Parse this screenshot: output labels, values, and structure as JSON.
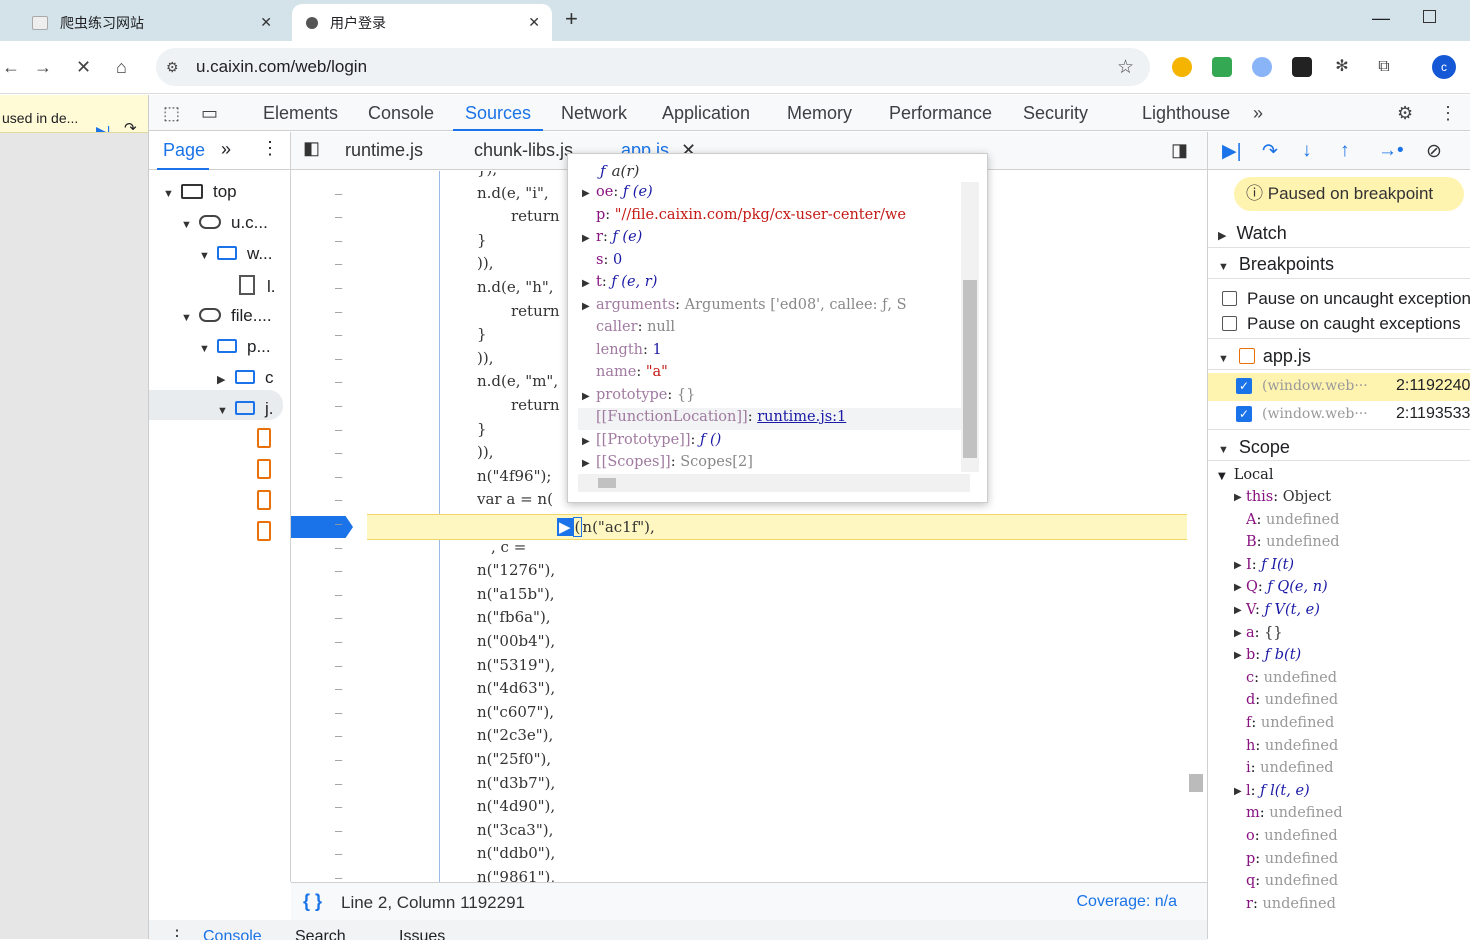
{
  "browser": {
    "tabs": [
      {
        "title": "爬虫练习网站",
        "active": false
      },
      {
        "title": "用户登录",
        "active": true
      }
    ],
    "url": "u.caixin.com/web/login",
    "profile_initial": "c"
  },
  "page_strip": {
    "debug_text": "used in de..."
  },
  "devtools": {
    "main_tabs": [
      "Elements",
      "Console",
      "Sources",
      "Network",
      "Application",
      "Memory",
      "Performance",
      "Security",
      "Lighthouse"
    ],
    "selected_tab": "Sources",
    "navigator": {
      "tab": "Page",
      "tree": [
        "top",
        "u.c...",
        "w...",
        "l.",
        "file....",
        "p...",
        "c",
        "j."
      ]
    },
    "editor": {
      "file_tabs": [
        "runtime.js",
        "chunk-libs.js",
        "app.js"
      ],
      "code_lines": [
        {
          "text": "}),",
          "indent": 476
        },
        {
          "text": "n.d(e, \"i\",",
          "indent": 476
        },
        {
          "text": "return",
          "indent": 510
        },
        {
          "text": "}",
          "indent": 476
        },
        {
          "text": ")),",
          "indent": 476
        },
        {
          "text": "n.d(e, \"h\",",
          "indent": 476
        },
        {
          "text": "return",
          "indent": 510
        },
        {
          "text": "}",
          "indent": 476
        },
        {
          "text": ")),",
          "indent": 476
        },
        {
          "text": "n.d(e, \"m\",",
          "indent": 476
        },
        {
          "text": "return",
          "indent": 510
        },
        {
          "text": "}",
          "indent": 476
        },
        {
          "text": ")),",
          "indent": 476
        },
        {
          "text": "n(\"4f96\");",
          "indent": 476
        },
        {
          "text": "var a = n(",
          "indent": 476
        },
        {
          "text": ", c = ",
          "indent": 490
        },
        {
          "text": "n(\"1276\"),",
          "indent": 476
        },
        {
          "text": "n(\"a15b\"),",
          "indent": 476
        },
        {
          "text": "n(\"fb6a\"),",
          "indent": 476
        },
        {
          "text": "n(\"00b4\"),",
          "indent": 476
        },
        {
          "text": "n(\"5319\"),",
          "indent": 476
        },
        {
          "text": "n(\"4d63\"),",
          "indent": 476
        },
        {
          "text": "n(\"c607\"),",
          "indent": 476
        },
        {
          "text": "n(\"2c3e\"),",
          "indent": 476
        },
        {
          "text": "n(\"25f0\"),",
          "indent": 476
        },
        {
          "text": "n(\"d3b7\"),",
          "indent": 476
        },
        {
          "text": "n(\"4d90\"),",
          "indent": 476
        },
        {
          "text": "n(\"3ca3\"),",
          "indent": 476
        },
        {
          "text": "n(\"ddb0\"),",
          "indent": 476
        },
        {
          "text": "n(\"9861\"),",
          "indent": 476
        }
      ],
      "exec_call": "n(\"ac1f\"),",
      "gutter_mark": "–",
      "status": {
        "position": "Line 2, Column 1192291",
        "coverage": "Coverage: n/a"
      }
    },
    "popover": {
      "header_fn": "ƒ",
      "header_sig": "a(r)",
      "rows": [
        {
          "key": "oe",
          "value": "ƒ (e)",
          "expandable": true,
          "kind": "fn"
        },
        {
          "key": "p",
          "value": "\"//file.caixin.com/pkg/cx-user-center/we",
          "expandable": false,
          "kind": "str"
        },
        {
          "key": "r",
          "value": "ƒ (e)",
          "expandable": true,
          "kind": "fn"
        },
        {
          "key": "s",
          "value": "0",
          "expandable": false,
          "kind": "num"
        },
        {
          "key": "t",
          "value": "ƒ (e, r)",
          "expandable": true,
          "kind": "fn"
        },
        {
          "key": "arguments",
          "value": "Arguments  ['ed08', callee: ƒ, S",
          "expandable": true,
          "kind": "gray"
        },
        {
          "key": "caller",
          "value": "null",
          "expandable": false,
          "kind": "gray"
        },
        {
          "key": "length",
          "value": "1",
          "expandable": false,
          "kind": "num"
        },
        {
          "key": "name",
          "value": "\"a\"",
          "expandable": false,
          "kind": "str"
        },
        {
          "key": "prototype",
          "value": "{}",
          "expandable": true,
          "kind": "obj"
        },
        {
          "key": "[[FunctionLocation]]",
          "value": "runtime.js:1",
          "expandable": false,
          "kind": "link"
        },
        {
          "key": "[[Prototype]]",
          "value": "ƒ ()",
          "expandable": true,
          "kind": "fn"
        },
        {
          "key": "[[Scopes]]",
          "value": "Scopes[2]",
          "expandable": true,
          "kind": "obj"
        }
      ]
    },
    "debugger": {
      "paused_text": "Paused on breakpoint",
      "sections": {
        "watch": "Watch",
        "breakpoints": "Breakpoints",
        "scope": "Scope",
        "local": "Local"
      },
      "pause_uncaught": "Pause on uncaught exceptions",
      "pause_caught": "Pause on caught exceptions",
      "bp_file": "app.js",
      "breakpoints": [
        {
          "src": "(window.web···",
          "loc": "2:1192240"
        },
        {
          "src": "(window.web···",
          "loc": "2:1193533"
        }
      ],
      "scope_vars": [
        {
          "k": "this",
          "v": "Object",
          "kind": "obj",
          "expandable": true
        },
        {
          "k": "A",
          "v": "undefined",
          "kind": "undef",
          "expandable": false
        },
        {
          "k": "B",
          "v": "undefined",
          "kind": "undef",
          "expandable": false
        },
        {
          "k": "I",
          "v": "ƒ I(t)",
          "kind": "fn",
          "expandable": true
        },
        {
          "k": "Q",
          "v": "ƒ Q(e, n)",
          "kind": "fn",
          "expandable": true
        },
        {
          "k": "V",
          "v": "ƒ V(t, e)",
          "kind": "fn",
          "expandable": true
        },
        {
          "k": "a",
          "v": "{}",
          "kind": "obj",
          "expandable": true
        },
        {
          "k": "b",
          "v": "ƒ b(t)",
          "kind": "fn",
          "expandable": true
        },
        {
          "k": "c",
          "v": "undefined",
          "kind": "undef",
          "expandable": false
        },
        {
          "k": "d",
          "v": "undefined",
          "kind": "undef",
          "expandable": false
        },
        {
          "k": "f",
          "v": "undefined",
          "kind": "undef",
          "expandable": false
        },
        {
          "k": "h",
          "v": "undefined",
          "kind": "undef",
          "expandable": false
        },
        {
          "k": "i",
          "v": "undefined",
          "kind": "undef",
          "expandable": false
        },
        {
          "k": "l",
          "v": "ƒ l(t, e)",
          "kind": "fn",
          "expandable": true
        },
        {
          "k": "m",
          "v": "undefined",
          "kind": "undef",
          "expandable": false
        },
        {
          "k": "o",
          "v": "undefined",
          "kind": "undef",
          "expandable": false
        },
        {
          "k": "p",
          "v": "undefined",
          "kind": "undef",
          "expandable": false
        },
        {
          "k": "q",
          "v": "undefined",
          "kind": "undef",
          "expandable": false
        },
        {
          "k": "r",
          "v": "undefined",
          "kind": "undef",
          "expandable": false
        }
      ]
    },
    "drawer_tabs": [
      "Console",
      "Search",
      "Issues"
    ]
  }
}
